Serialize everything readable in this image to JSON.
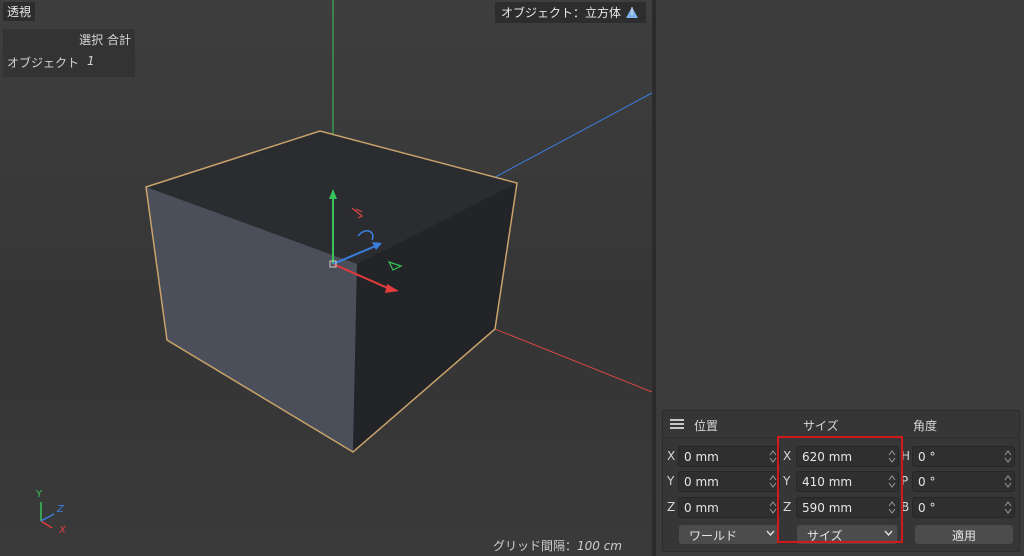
{
  "viewport": {
    "name": "透視",
    "object_label": "オブジェクト：立方体",
    "object_icon": "cube-object-icon",
    "stats": {
      "header": "選択 合計",
      "row_label": "オブジェクト",
      "row_value": "1"
    },
    "grid_info": {
      "label": "グリッド間隔：",
      "value": "100 cm"
    },
    "axis_labels": {
      "x": "X",
      "y": "Y",
      "z": "Z"
    },
    "colors": {
      "x_axis": "#e23b3b",
      "y_axis": "#37c45c",
      "z_axis": "#3b7ee0",
      "selection_outline": "#c9a26b"
    }
  },
  "coordinates": {
    "menu_icon": "hamburger-menu-icon",
    "headers": {
      "position": "位置",
      "size": "サイズ",
      "rotation": "角度"
    },
    "position": [
      {
        "axis": "X",
        "value": "0 mm"
      },
      {
        "axis": "Y",
        "value": "0 mm"
      },
      {
        "axis": "Z",
        "value": "0 mm"
      }
    ],
    "size": [
      {
        "axis": "X",
        "value": "620 mm"
      },
      {
        "axis": "Y",
        "value": "410 mm"
      },
      {
        "axis": "Z",
        "value": "590 mm"
      }
    ],
    "rotation": [
      {
        "axis": "H",
        "value": "0 °"
      },
      {
        "axis": "P",
        "value": "0 °"
      },
      {
        "axis": "B",
        "value": "0 °"
      }
    ],
    "position_mode": "ワールド",
    "size_mode": "サイズ",
    "apply_label": "適用",
    "highlight_color": "#d0191d"
  }
}
